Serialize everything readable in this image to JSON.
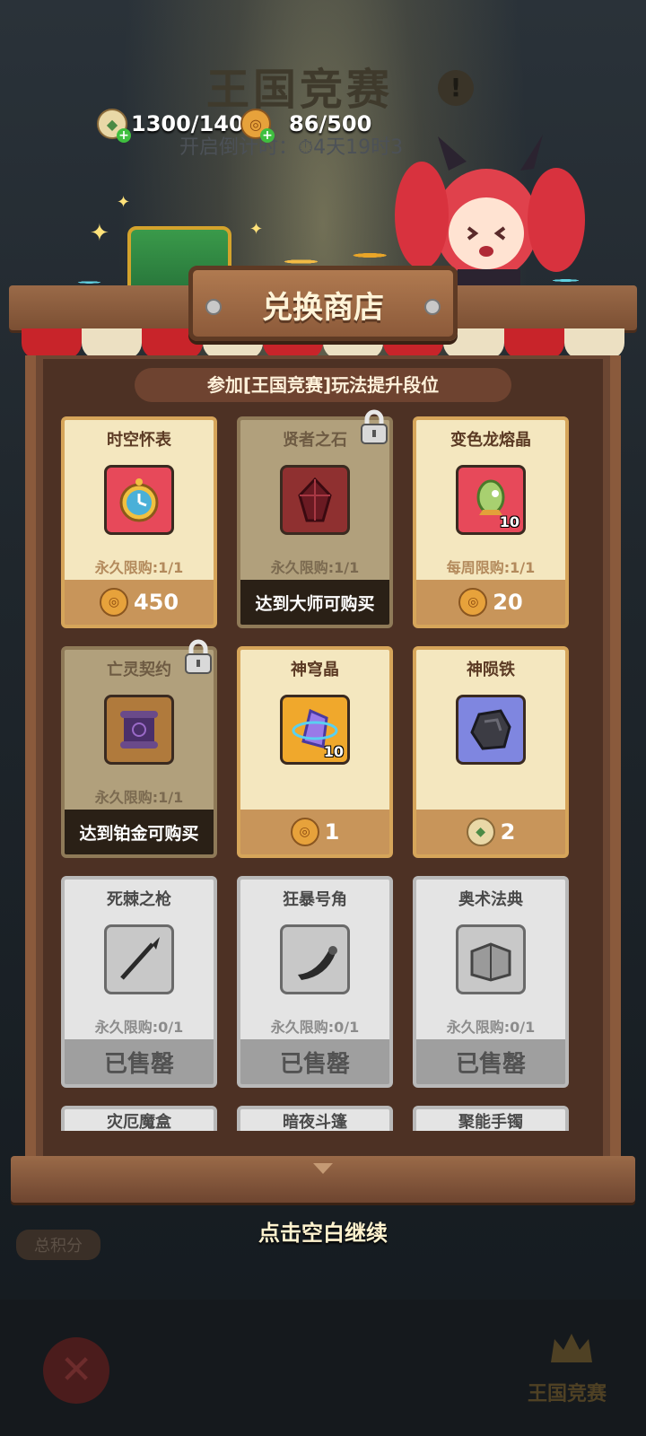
{
  "background": {
    "title": "王国竞赛",
    "countdown": "开启倒计时：⏱4天19时3",
    "total_score_label": "总积分",
    "bottom_tab_label": "王国竞赛"
  },
  "currencies": [
    {
      "icon": "green-gem-icon",
      "value": "1300/1400"
    },
    {
      "icon": "coin-icon",
      "value": "86/500"
    }
  ],
  "shop": {
    "title": "兑换商店",
    "subtitle": "参加[王国竞赛]玩法提升段位",
    "items": [
      {
        "name": "时空怀表",
        "state": "gold",
        "limit": "永久限购:1/1",
        "price": "450",
        "currency": "coin",
        "qty": "",
        "locked": false
      },
      {
        "name": "贤者之石",
        "state": "locked",
        "limit": "永久限购:1/1",
        "unlock_text": "达到大师可购买",
        "qty": "",
        "locked": true
      },
      {
        "name": "变色龙熔晶",
        "state": "gold",
        "limit": "每周限购:1/1",
        "price": "20",
        "currency": "coin",
        "qty": "10",
        "locked": false
      },
      {
        "name": "亡灵契约",
        "state": "locked",
        "limit": "永久限购:1/1",
        "unlock_text": "达到铂金可购买",
        "qty": "",
        "locked": true
      },
      {
        "name": "神穹晶",
        "state": "gold",
        "limit": "",
        "price": "1",
        "currency": "coin",
        "qty": "10",
        "locked": false
      },
      {
        "name": "神陨铁",
        "state": "gold",
        "limit": "",
        "price": "2",
        "currency": "gem",
        "qty": "",
        "locked": false
      },
      {
        "name": "死棘之枪",
        "state": "sold",
        "limit": "永久限购:0/1",
        "sold_text": "已售罄",
        "qty": "",
        "locked": false
      },
      {
        "name": "狂暴号角",
        "state": "sold",
        "limit": "永久限购:0/1",
        "sold_text": "已售罄",
        "qty": "",
        "locked": false
      },
      {
        "name": "奥术法典",
        "state": "sold",
        "limit": "永久限购:0/1",
        "sold_text": "已售罄",
        "qty": "",
        "locked": false
      },
      {
        "name": "灾厄魔盒",
        "state": "sold"
      },
      {
        "name": "暗夜斗篷",
        "state": "sold"
      },
      {
        "name": "聚能手镯",
        "state": "sold"
      }
    ]
  },
  "continue_hint": "点击空白继续"
}
